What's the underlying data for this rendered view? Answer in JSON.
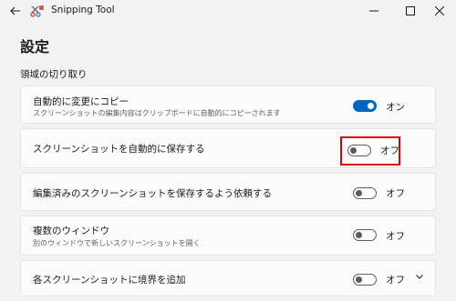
{
  "window": {
    "title": "Snipping Tool"
  },
  "page": {
    "title": "設定",
    "section_title": "領域の切り取り"
  },
  "settings": [
    {
      "label": "自動的に変更にコピー",
      "description": "スクリーンショットの編集内容はクリップボードに自動的にコピーされます",
      "state": "オン",
      "on": true
    },
    {
      "label": "スクリーンショットを自動的に保存する",
      "description": "",
      "state": "オフ",
      "on": false
    },
    {
      "label": "編集済みのスクリーンショットを保存するよう依頼する",
      "description": "",
      "state": "オフ",
      "on": false
    },
    {
      "label": "複数のウィンドウ",
      "description": "別のウィンドウで新しいスクリーンショットを開く",
      "state": "オフ",
      "on": false
    },
    {
      "label": "各スクリーンショットに境界を追加",
      "description": "",
      "state": "オフ",
      "on": false
    }
  ],
  "colors": {
    "accent": "#0067c0",
    "highlight": "#e00000",
    "background": "#f3f3f3",
    "card": "#fbfbfb"
  },
  "icons": [
    "back-arrow-icon",
    "snipping-tool-app-icon",
    "minimize-icon",
    "maximize-icon",
    "close-icon",
    "chevron-down-icon"
  ]
}
